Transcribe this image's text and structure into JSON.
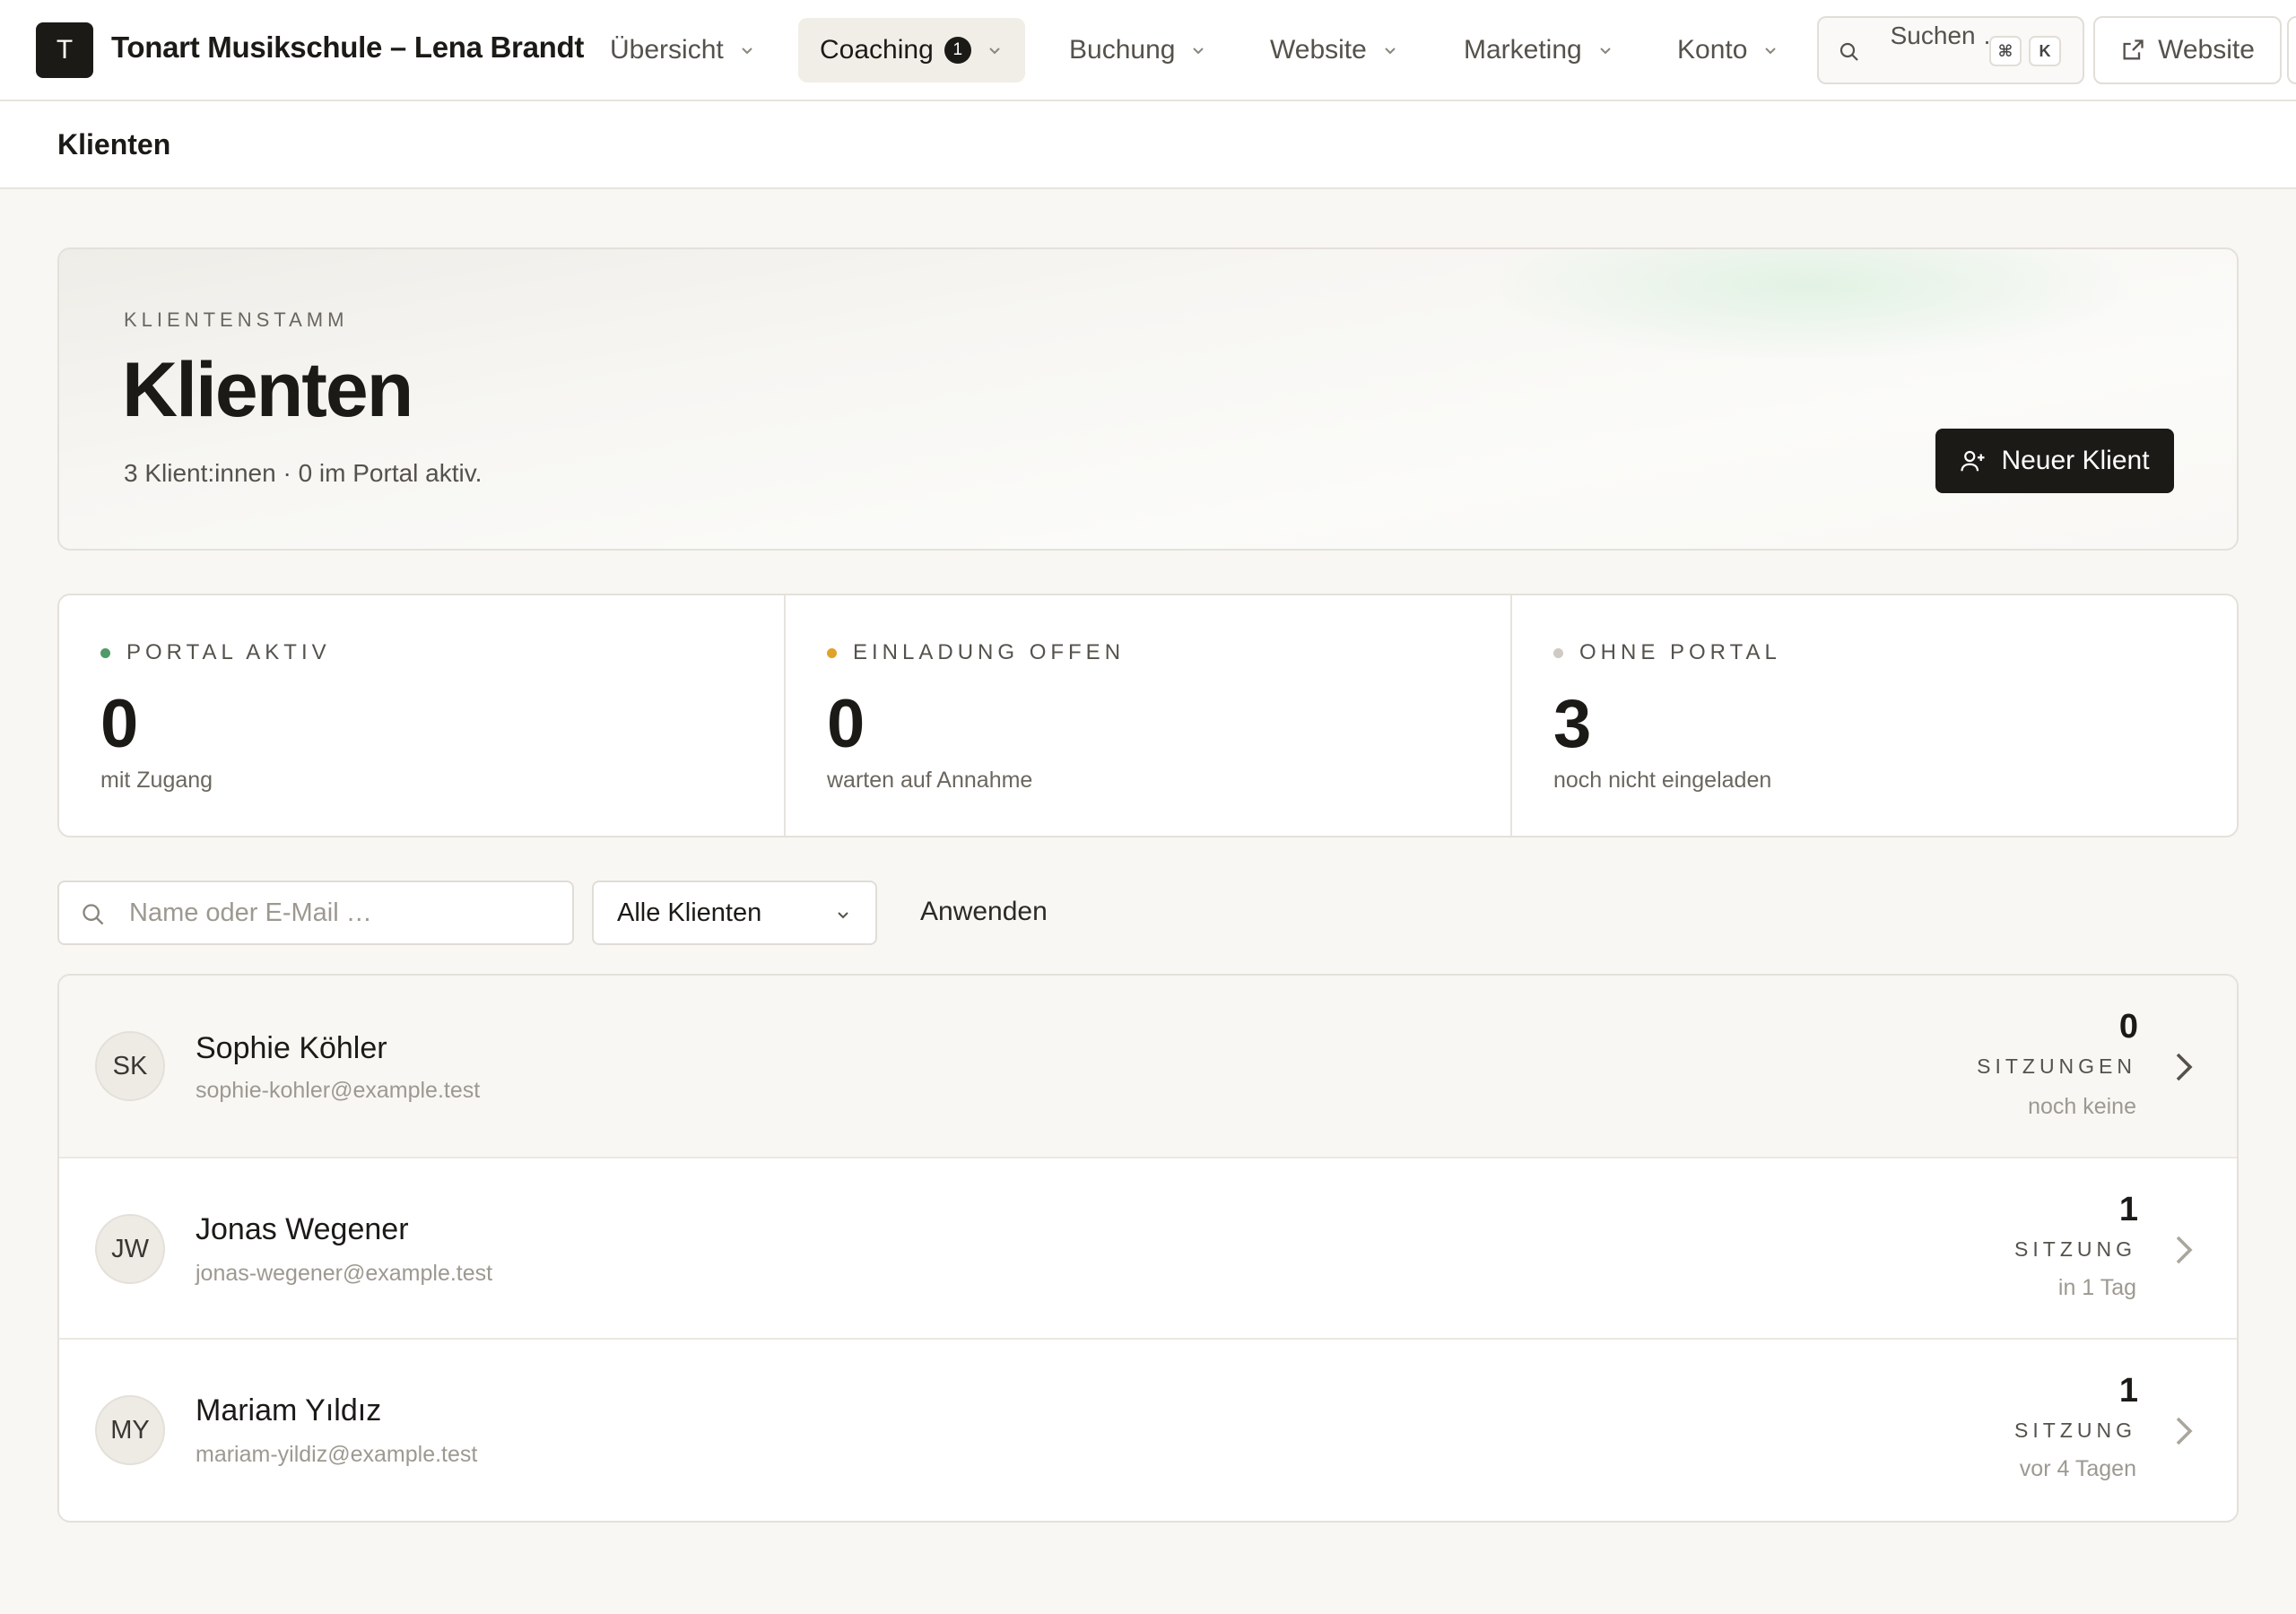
{
  "brand": {
    "initial": "T",
    "name": "Tonart Musikschule – Lena Brandt"
  },
  "nav": {
    "items": [
      {
        "label": "Übersicht"
      },
      {
        "label": "Coaching",
        "badge": "1",
        "active": true
      },
      {
        "label": "Buchung"
      },
      {
        "label": "Website"
      },
      {
        "label": "Marketing"
      },
      {
        "label": "Konto"
      }
    ],
    "search": {
      "label": "Suchen …",
      "kbd_cmd": "⌘",
      "kbd_key": "K"
    },
    "website_button": "Website"
  },
  "subheader": {
    "title": "Klienten"
  },
  "hero": {
    "eyebrow": "KLIENTENSTAMM",
    "title": "Klienten",
    "summary": "3 Klient:innen · 0 im Portal aktiv.",
    "new_button": "Neuer Klient"
  },
  "stats": [
    {
      "label": "PORTAL AKTIV",
      "value": "0",
      "caption": "mit Zugang",
      "dot_color": "#4f9a68"
    },
    {
      "label": "EINLADUNG OFFEN",
      "value": "0",
      "caption": "warten auf Annahme",
      "dot_color": "#e0a22b"
    },
    {
      "label": "OHNE PORTAL",
      "value": "3",
      "caption": "noch nicht eingeladen",
      "dot_color": "#cfcbc4"
    }
  ],
  "filter": {
    "search_placeholder": "Name oder E-Mail …",
    "search_value": "",
    "select_value": "Alle Klienten",
    "apply_label": "Anwenden"
  },
  "clients": [
    {
      "initials": "SK",
      "name": "Sophie Köhler",
      "email": "sophie-kohler@example.test",
      "count": "0",
      "unit": "SITZUNGEN",
      "when": "noch keine"
    },
    {
      "initials": "JW",
      "name": "Jonas Wegener",
      "email": "jonas-wegener@example.test",
      "count": "1",
      "unit": "SITZUNG",
      "when": "in 1 Tag"
    },
    {
      "initials": "MY",
      "name": "Mariam Yıldız",
      "email": "mariam-yildiz@example.test",
      "count": "1",
      "unit": "SITZUNG",
      "when": "vor 4 Tagen"
    }
  ],
  "colors": {
    "accent": "#1c1a17",
    "background": "#f8f7f4"
  }
}
